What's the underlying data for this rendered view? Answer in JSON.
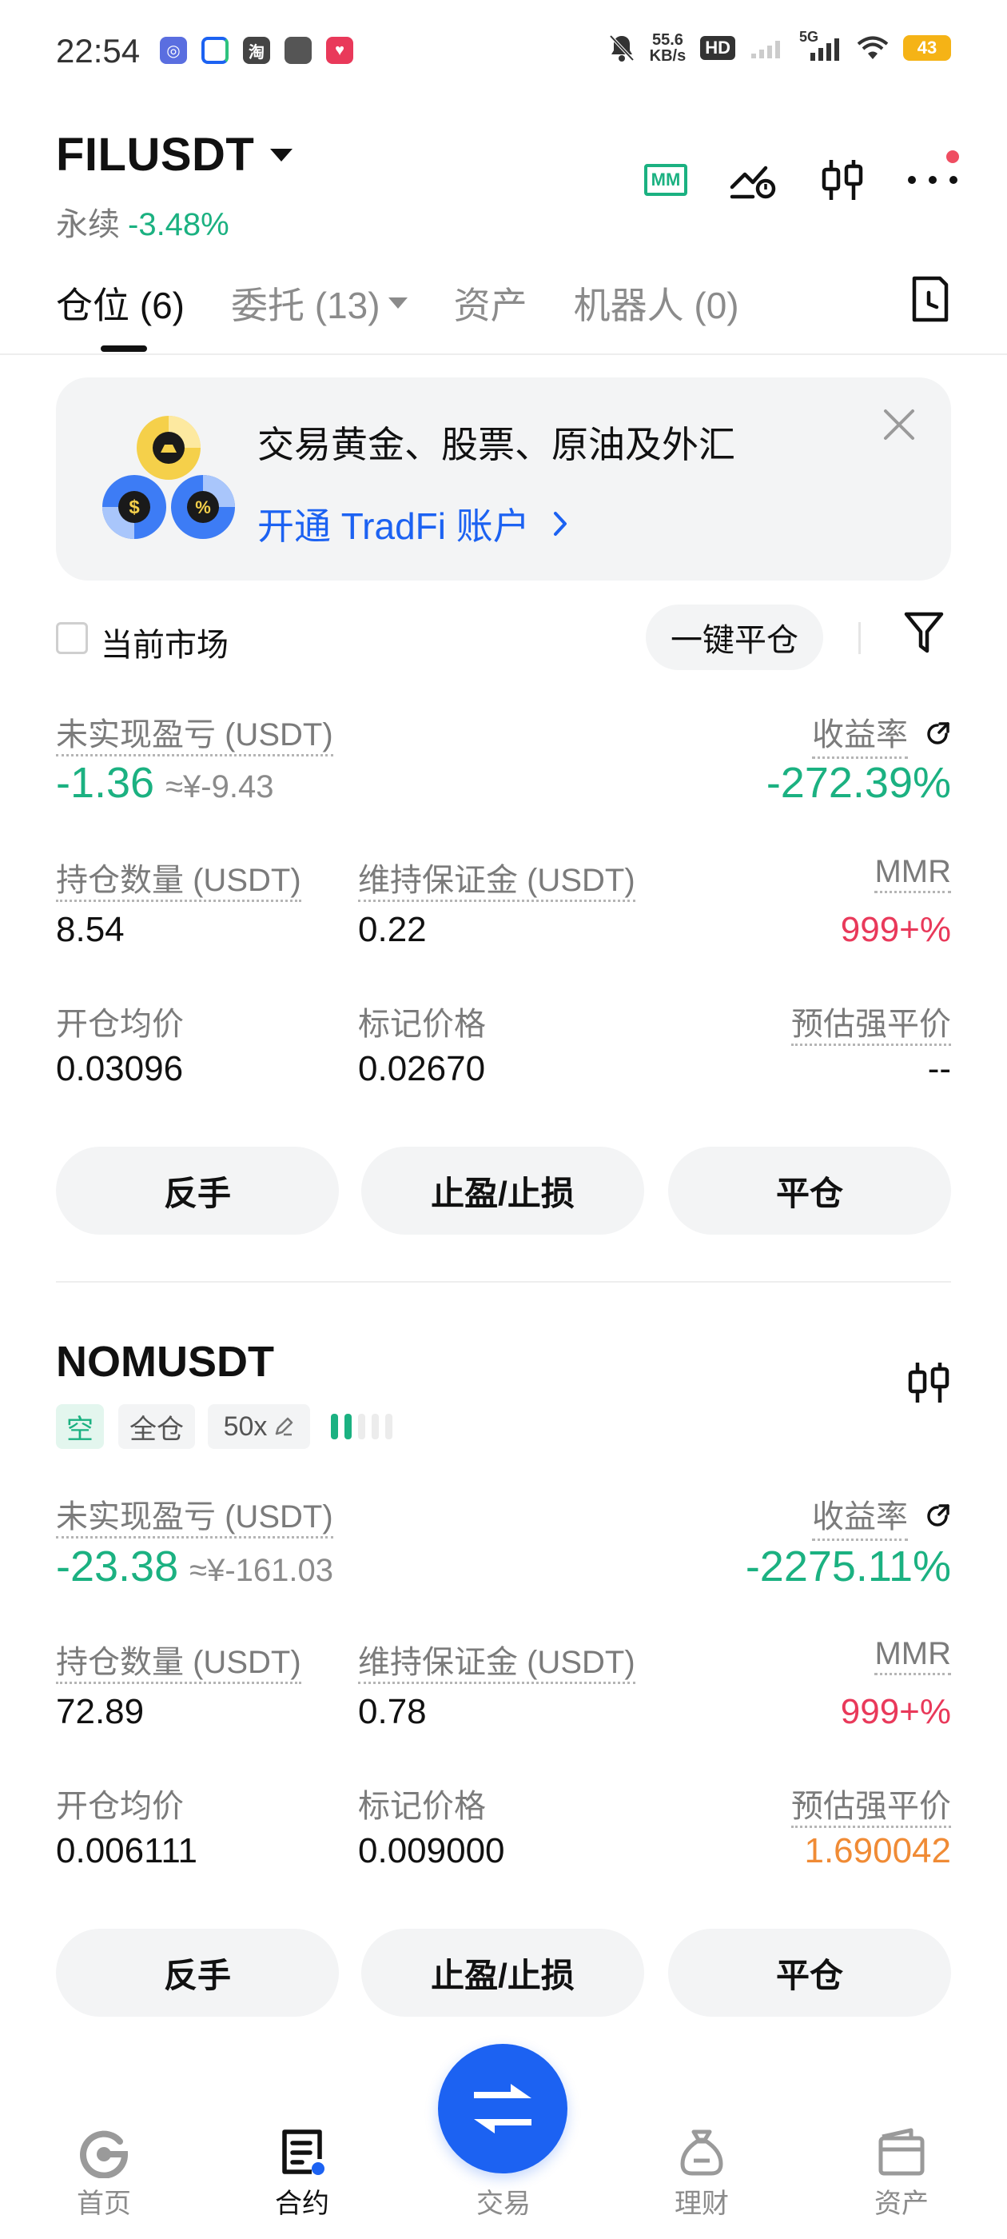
{
  "status": {
    "time": "22:54",
    "speed_value": "55.6",
    "speed_unit": "KB/s",
    "hd": "HD",
    "network": "5G",
    "battery": "43"
  },
  "header": {
    "pair": "FILUSDT",
    "type": "永续",
    "change": "-3.48%",
    "mm_badge": "MM"
  },
  "tabs": [
    {
      "label": "仓位 (6)"
    },
    {
      "label": "委托 (13)"
    },
    {
      "label": "资产"
    },
    {
      "label": "机器人 (0)"
    }
  ],
  "banner": {
    "title": "交易黄金、股票、原油及外汇",
    "link": "开通 TradFi 账户",
    "coin_dollar": "$",
    "coin_percent": "%"
  },
  "filter": {
    "current_market": "当前市场",
    "close_all": "一键平仓"
  },
  "positions": [
    {
      "unrealized_label": "未实现盈亏 (USDT)",
      "unrealized": "-1.36",
      "unrealized_cny": "≈¥-9.43",
      "roe_label": "收益率",
      "roe": "-272.39%",
      "size_label": "持仓数量 (USDT)",
      "size": "8.54",
      "margin_label": "维持保证金 (USDT)",
      "margin": "0.22",
      "mmr_label": "MMR",
      "mmr": "999+%",
      "entry_label": "开仓均价",
      "entry": "0.03096",
      "mark_label": "标记价格",
      "mark": "0.02670",
      "liq_label": "预估强平价",
      "liq": "--",
      "btn_reverse": "反手",
      "btn_tpsl": "止盈/止损",
      "btn_close": "平仓"
    },
    {
      "symbol": "NOMUSDT",
      "side": "空",
      "margin_mode": "全仓",
      "leverage": "50x",
      "unrealized_label": "未实现盈亏 (USDT)",
      "unrealized": "-23.38",
      "unrealized_cny": "≈¥-161.03",
      "roe_label": "收益率",
      "roe": "-2275.11%",
      "size_label": "持仓数量 (USDT)",
      "size": "72.89",
      "margin_label": "维持保证金 (USDT)",
      "margin": "0.78",
      "mmr_label": "MMR",
      "mmr": "999+%",
      "entry_label": "开仓均价",
      "entry": "0.006111",
      "mark_label": "标记价格",
      "mark": "0.009000",
      "liq_label": "预估强平价",
      "liq": "1.690042",
      "btn_reverse": "反手",
      "btn_tpsl": "止盈/止损",
      "btn_close": "平仓"
    }
  ],
  "nav": [
    {
      "label": "首页",
      "icon": "home-icon"
    },
    {
      "label": "合约",
      "icon": "contract-icon"
    },
    {
      "label": "交易",
      "icon": "swap-icon"
    },
    {
      "label": "理财",
      "icon": "earn-icon"
    },
    {
      "label": "资产",
      "icon": "wallet-icon"
    }
  ],
  "colors": {
    "green": "#1bb181",
    "red": "#e9395a",
    "orange": "#f08b35",
    "blue": "#1c62f2"
  }
}
